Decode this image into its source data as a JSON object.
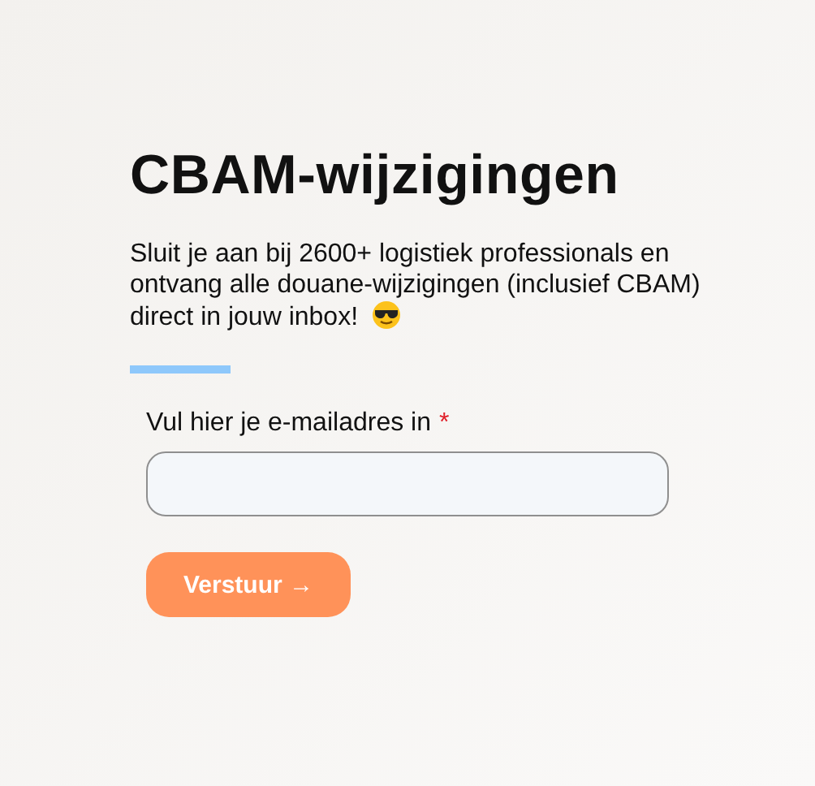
{
  "title": "CBAM-wijzigingen",
  "intro": "Sluit je aan bij 2600+ logistiek professionals en ontvang alle douane-wijzigingen (inclusief CBAM) direct in jouw inbox!",
  "email_field": {
    "label": "Vul hier je e-mailadres in",
    "required_mark": "*"
  },
  "submit_button": {
    "label": "Verstuur →"
  }
}
